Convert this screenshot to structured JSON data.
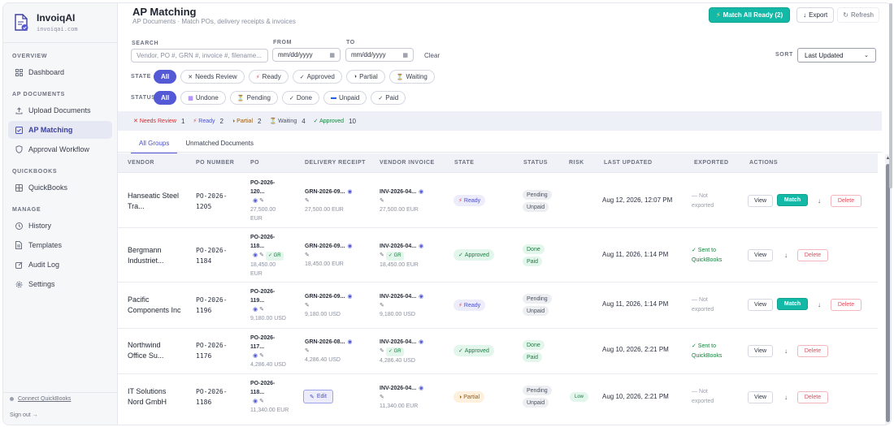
{
  "brand": {
    "name": "InvoiqAI",
    "domain": "invoiqai.com"
  },
  "sidebar": {
    "sections": {
      "overview": "OVERVIEW",
      "ap_documents": "AP DOCUMENTS",
      "quickbooks": "QUICKBOOKS",
      "manage": "MANAGE"
    },
    "items": {
      "dashboard": "Dashboard",
      "upload": "Upload Documents",
      "matching": "AP Matching",
      "approval": "Approval Workflow",
      "quickbooks": "QuickBooks",
      "history": "History",
      "templates": "Templates",
      "audit": "Audit Log",
      "settings": "Settings"
    },
    "connect": "Connect QuickBooks",
    "signout": "Sign out →"
  },
  "header": {
    "title": "AP Matching",
    "subtitle": "AP Documents · Match POs, delivery receipts & invoices",
    "match_all": "Match All Ready (2)",
    "export": "Export",
    "refresh": "Refresh"
  },
  "filters": {
    "search_label": "SEARCH",
    "search_placeholder": "Vendor, PO #, GRN #, invoice #, filename...",
    "from_label": "FROM",
    "to_label": "TO",
    "date_placeholder": "mm/dd/yyyy",
    "clear": "Clear",
    "sort_label": "SORT",
    "sort_value": "Last Updated",
    "state_label": "STATE",
    "state_chips": [
      "All",
      "Needs Review",
      "Ready",
      "Approved",
      "Partial",
      "Waiting"
    ],
    "status_label": "STATUS",
    "status_chips": [
      "All",
      "Undone",
      "Pending",
      "Done",
      "Unpaid",
      "Paid"
    ]
  },
  "summary": [
    {
      "label": "Needs Review",
      "count": "1",
      "color": "#dc2626"
    },
    {
      "label": "Ready",
      "count": "2",
      "color": "#4b4fc7"
    },
    {
      "label": "Partial",
      "count": "2",
      "color": "#9a5b0f"
    },
    {
      "label": "Waiting",
      "count": "4",
      "color": "#4b5060"
    },
    {
      "label": "Approved",
      "count": "10",
      "color": "#15803d"
    }
  ],
  "tabs": [
    "All Groups",
    "Unmatched Documents"
  ],
  "columns": [
    "VENDOR",
    "PO NUMBER",
    "PO",
    "DELIVERY RECEIPT",
    "VENDOR INVOICE",
    "STATE",
    "STATUS",
    "RISK",
    "LAST UPDATED",
    "EXPORTED",
    "ACTIONS"
  ],
  "rows": [
    {
      "vendor": [
        "Hanseatic Steel",
        "Tra..."
      ],
      "po_number": [
        "PO-2026-",
        "1205"
      ],
      "po": [
        "PO-2026-",
        "120...",
        "27,500.00",
        "EUR"
      ],
      "grn": "GRN-2026-09...",
      "grn_amt": "27,500.00 EUR",
      "inv": "INV-2026-04...",
      "inv_amt": "27,500.00 EUR",
      "inv_gr": "",
      "state": "Ready",
      "status": [
        "Pending",
        "Unpaid"
      ],
      "risk": "",
      "updated": "Aug 12, 2026, 12:07 PM",
      "exported": [
        "— Not",
        "exported"
      ],
      "view": "View",
      "match": "Match",
      "delete": "Delete"
    },
    {
      "vendor": [
        "Bergmann",
        "Industriet..."
      ],
      "po_number": [
        "PO-2026-",
        "1184"
      ],
      "po": [
        "PO-2026-",
        "118...",
        "18,450.00",
        "EUR"
      ],
      "grn": "GRN-2026-09...",
      "grn_amt": "18,450.00 EUR",
      "inv": "INV-2026-04...",
      "inv_amt": "18,450.00 EUR",
      "inv_gr": "✓ GR",
      "po_gr": "✓ GR",
      "state": "Approved",
      "status": [
        "Done",
        "Paid"
      ],
      "risk": "",
      "updated": "Aug 11, 2026, 1:14 PM",
      "exported": [
        "✓ Sent to",
        "QuickBooks"
      ],
      "view": "View",
      "match": "",
      "delete": "Delete"
    },
    {
      "vendor": [
        "Pacific",
        "Components Inc"
      ],
      "po_number": [
        "PO-2026-",
        "1196"
      ],
      "po": [
        "PO-2026-",
        "119...",
        "9,180.00 USD"
      ],
      "grn": "GRN-2026-09...",
      "grn_amt": "9,180.00 USD",
      "inv": "INV-2026-04...",
      "inv_amt": "9,180.00 USD",
      "inv_gr": "",
      "state": "Ready",
      "status": [
        "Pending",
        "Unpaid"
      ],
      "risk": "",
      "updated": "Aug 11, 2026, 1:14 PM",
      "exported": [
        "— Not",
        "exported"
      ],
      "view": "View",
      "match": "Match",
      "delete": "Delete"
    },
    {
      "vendor": [
        "Northwind",
        "Office Su..."
      ],
      "po_number": [
        "PO-2026-",
        "1176"
      ],
      "po": [
        "PO-2026-",
        "117...",
        "4,286.40 USD"
      ],
      "grn": "GRN-2026-08...",
      "grn_amt": "4,286.40 USD",
      "inv": "INV-2026-04...",
      "inv_amt": "4,286.40 USD",
      "inv_gr": "✓ GR",
      "state": "Approved",
      "status": [
        "Done",
        "Paid"
      ],
      "risk": "",
      "updated": "Aug 10, 2026, 2:21 PM",
      "exported": [
        "✓ Sent to",
        "QuickBooks"
      ],
      "view": "View",
      "match": "",
      "delete": "Delete"
    },
    {
      "vendor": [
        "IT Solutions",
        "Nord GmbH"
      ],
      "po_number": [
        "PO-2026-",
        "1186"
      ],
      "po": [
        "PO-2026-",
        "118...",
        "11,340.00 EUR"
      ],
      "grn": "",
      "grn_amt": "",
      "edit": "Edit",
      "inv": "INV-2026-04...",
      "inv_amt": "11,340.00 EUR",
      "inv_gr": "",
      "state": "Partial",
      "status": [
        "Pending",
        "Unpaid"
      ],
      "risk": "Low",
      "updated": "Aug 10, 2026, 2:21 PM",
      "exported": [
        "— Not",
        "exported"
      ],
      "view": "View",
      "match": "",
      "delete": "Delete"
    }
  ]
}
